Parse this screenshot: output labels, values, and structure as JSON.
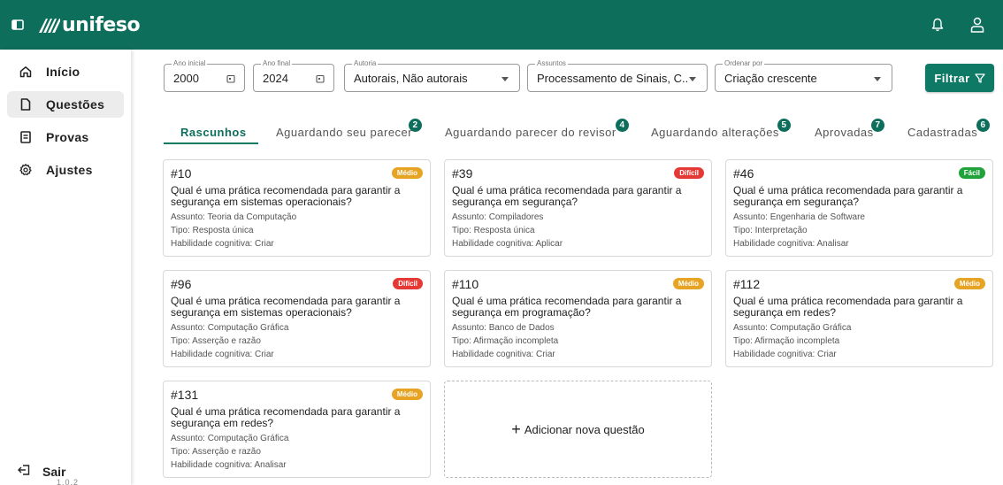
{
  "header": {
    "logo_text": "unifeso",
    "brand_color": "#0e6e5c"
  },
  "sidebar": {
    "items": [
      {
        "label": "Início",
        "icon": "home-icon"
      },
      {
        "label": "Questões",
        "icon": "document-icon"
      },
      {
        "label": "Provas",
        "icon": "exam-icon"
      },
      {
        "label": "Ajustes",
        "icon": "gear-icon"
      }
    ],
    "exit_label": "Sair",
    "version": "1.0.2"
  },
  "filters": {
    "ano_inicial": {
      "label": "Ano inicial",
      "value": "2000"
    },
    "ano_final": {
      "label": "Ano final",
      "value": "2024"
    },
    "autoria": {
      "label": "Autoria",
      "value": "Autorais, Não autorais"
    },
    "assuntos": {
      "label": "Assuntos",
      "value": "Processamento de Sinais, C..."
    },
    "ordenar": {
      "label": "Ordenar por",
      "value": "Criação crescente"
    },
    "filter_button": "Filtrar"
  },
  "tabs": [
    {
      "label": "Rascunhos",
      "badge": ""
    },
    {
      "label": "Aguardando seu parecer",
      "badge": "2"
    },
    {
      "label": "Aguardando parecer do revisor",
      "badge": "4"
    },
    {
      "label": "Aguardando alterações",
      "badge": "5"
    },
    {
      "label": "Aprovadas",
      "badge": "7"
    },
    {
      "label": "Cadastradas",
      "badge": "6"
    }
  ],
  "difficulty_colors": {
    "Médio": "#e6a324",
    "Difícil": "#e53935",
    "Fácil": "#21a33c"
  },
  "cards": [
    {
      "id": "#10",
      "difficulty": "Médio",
      "question": "Qual é uma prática recomendada para garantir a segurança em sistemas operacionais?",
      "subject": "Assunto: Teoria da Computação",
      "type": "Tipo: Resposta única",
      "skill": "Habilidade cognitiva: Criar"
    },
    {
      "id": "#39",
      "difficulty": "Difícil",
      "question": "Qual é uma prática recomendada para garantir a segurança em segurança?",
      "subject": "Assunto: Compiladores",
      "type": "Tipo: Resposta única",
      "skill": "Habilidade cognitiva: Aplicar"
    },
    {
      "id": "#46",
      "difficulty": "Fácil",
      "question": "Qual é uma prática recomendada para garantir a segurança em segurança?",
      "subject": "Assunto: Engenharia de Software",
      "type": "Tipo: Interpretação",
      "skill": "Habilidade cognitiva: Analisar"
    },
    {
      "id": "#96",
      "difficulty": "Difícil",
      "question": "Qual é uma prática recomendada para garantir a segurança em sistemas operacionais?",
      "subject": "Assunto: Computação Gráfica",
      "type": "Tipo: Asserção e razão",
      "skill": "Habilidade cognitiva: Criar"
    },
    {
      "id": "#110",
      "difficulty": "Médio",
      "question": "Qual é uma prática recomendada para garantir a segurança em programação?",
      "subject": "Assunto: Banco de Dados",
      "type": "Tipo: Afirmação incompleta",
      "skill": "Habilidade cognitiva: Criar"
    },
    {
      "id": "#112",
      "difficulty": "Médio",
      "question": "Qual é uma prática recomendada para garantir a segurança em redes?",
      "subject": "Assunto: Computação Gráfica",
      "type": "Tipo: Afirmação incompleta",
      "skill": "Habilidade cognitiva: Criar"
    },
    {
      "id": "#131",
      "difficulty": "Médio",
      "question": "Qual é uma prática recomendada para garantir a segurança em redes?",
      "subject": "Assunto: Computação Gráfica",
      "type": "Tipo: Asserção e razão",
      "skill": "Habilidade cognitiva: Analisar"
    }
  ],
  "add_card": {
    "label": "Adicionar nova questão"
  }
}
